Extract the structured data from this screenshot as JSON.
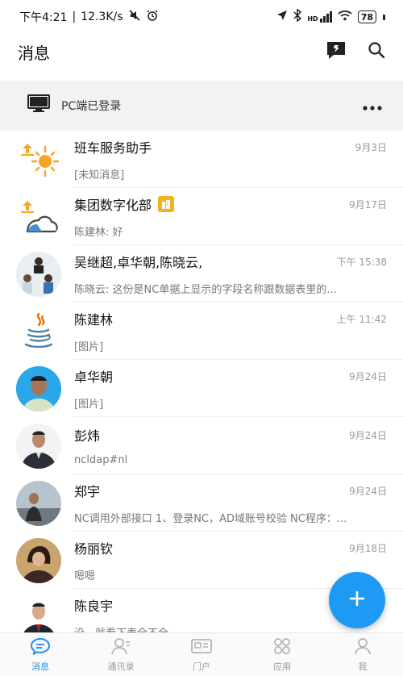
{
  "status_bar": {
    "time": "下午4:21",
    "separator": "|",
    "speed": "12.3K/s",
    "network": "HD",
    "battery": "78"
  },
  "header": {
    "title": "消息"
  },
  "pc_banner": {
    "text": "PC端已登录"
  },
  "conversations": [
    {
      "name": "班车服务助手",
      "time": "9月3日",
      "preview": "[未知消息]"
    },
    {
      "name": "集团数字化部",
      "time": "9月17日",
      "preview": "陈建林: 好"
    },
    {
      "name": "吴继超,卓华朝,陈晓云,",
      "time": "下午 15:38",
      "preview": "陈晓云: 这份是NC单据上显示的字段名称跟数据表里的..."
    },
    {
      "name": "陈建林",
      "time": "上午 11:42",
      "preview": "[图片]"
    },
    {
      "name": "卓华朝",
      "time": "9月24日",
      "preview": "[图片]"
    },
    {
      "name": "彭炜",
      "time": "9月24日",
      "preview": "ncldap#nl"
    },
    {
      "name": "郑宇",
      "time": "9月24日",
      "preview": "NC调用外部接口 1、登录NC，AD域账号校验 NC程序：..."
    },
    {
      "name": "杨丽钦",
      "time": "9月18日",
      "preview": "嗯嗯"
    },
    {
      "name": "陈良宇",
      "time": "",
      "preview": "没，就看下表全不全"
    }
  ],
  "fab": {
    "icon": "plus-icon"
  },
  "bottom_nav": [
    {
      "label": "消息",
      "icon": "chat-bubble-icon",
      "active": true
    },
    {
      "label": "通讯录",
      "icon": "contacts-icon",
      "active": false
    },
    {
      "label": "门户",
      "icon": "portal-icon",
      "active": false
    },
    {
      "label": "应用",
      "icon": "apps-grid-icon",
      "active": false
    },
    {
      "label": "我",
      "icon": "profile-icon",
      "active": false
    }
  ],
  "colors": {
    "accent": "#1e9af5",
    "active_nav": "#1e8ef0",
    "badge": "#f2b21b"
  }
}
